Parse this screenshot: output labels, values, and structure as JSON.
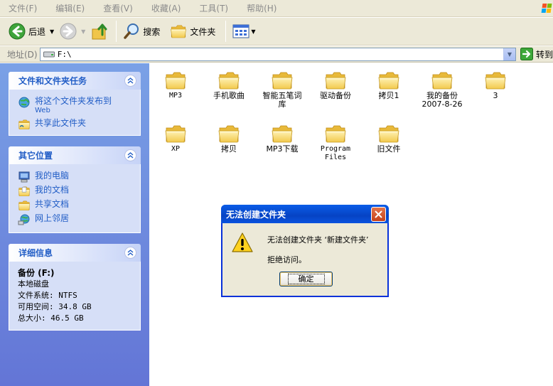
{
  "menu": [
    "文件(F)",
    "编辑(E)",
    "查看(V)",
    "收藏(A)",
    "工具(T)",
    "帮助(H)"
  ],
  "toolbar": {
    "back_label": "后退",
    "search_label": "搜索",
    "folders_label": "文件夹"
  },
  "address": {
    "label": "地址(D)",
    "path": "F:\\",
    "go_label": "转到"
  },
  "tasks_panel": {
    "title": "文件和文件夹任务",
    "items": [
      {
        "label": "将这个文件夹发布到",
        "sub": "Web"
      },
      {
        "label": "共享此文件夹"
      }
    ]
  },
  "places_panel": {
    "title": "其它位置",
    "items": [
      "我的电脑",
      "我的文档",
      "共享文档",
      "网上邻居"
    ]
  },
  "details_panel": {
    "title": "详细信息",
    "drive_name": "备份 (F:)",
    "drive_type": "本地磁盘",
    "file_system": "文件系统: NTFS",
    "free_space": "可用空间: 34.8 GB",
    "total_size": "总大小: 46.5 GB"
  },
  "folders": [
    "MP3",
    "手机歌曲",
    "智能五笔词库",
    "驱动备份",
    "拷贝1",
    "我的备份 2007-8-26",
    "3",
    "XP",
    "拷贝",
    "MP3下载",
    "Program Files",
    "旧文件"
  ],
  "dialog": {
    "title": "无法创建文件夹",
    "message_line1": "无法创建文件夹 ‘新建文件夹’",
    "message_line2": "拒绝访问。",
    "ok_label": "确定"
  }
}
